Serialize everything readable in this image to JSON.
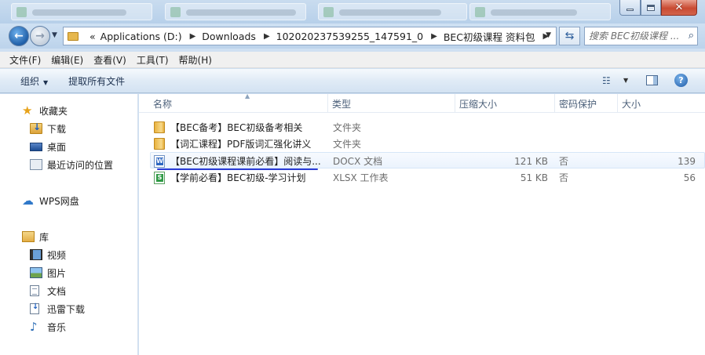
{
  "navigation": {
    "path": [
      "Applications (D:)",
      "Downloads",
      "102020237539255_147591_0",
      "BEC初级课程 资料包"
    ],
    "overflow_glyph": "«",
    "search_placeholder": "搜索 BEC初级课程 ..."
  },
  "menu": [
    "文件(F)",
    "编辑(E)",
    "查看(V)",
    "工具(T)",
    "帮助(H)"
  ],
  "commands": {
    "organize": "组织",
    "extract_all": "提取所有文件"
  },
  "sidebar": {
    "favorites": {
      "label": "收藏夹",
      "items": [
        "下载",
        "桌面",
        "最近访问的位置"
      ]
    },
    "wps": "WPS网盘",
    "libraries": {
      "label": "库",
      "items": [
        "视频",
        "图片",
        "文档",
        "迅雷下载",
        "音乐"
      ]
    }
  },
  "columns": [
    "名称",
    "类型",
    "压缩大小",
    "密码保护",
    "大小"
  ],
  "files": [
    {
      "name": "【BEC备考】BEC初级备考相关",
      "type": "文件夹",
      "packed": "",
      "password": "",
      "size": "",
      "icon": "folder-icon"
    },
    {
      "name": "【词汇课程】PDF版词汇强化讲义",
      "type": "文件夹",
      "packed": "",
      "password": "",
      "size": "",
      "icon": "folder-icon"
    },
    {
      "name": "【BEC初级课程课前必看】阅读与...",
      "type": "DOCX 文档",
      "packed": "121 KB",
      "password": "否",
      "size": "139",
      "icon": "docx-icon"
    },
    {
      "name": "【学前必看】BEC初级-学习计划",
      "type": "XLSX 工作表",
      "packed": "51 KB",
      "password": "否",
      "size": "56",
      "icon": "xlsx-icon"
    }
  ],
  "colors": {
    "accent_underline": "#2b3bd6",
    "chrome": "#cfe0f2",
    "close_button": "#c94a32"
  }
}
